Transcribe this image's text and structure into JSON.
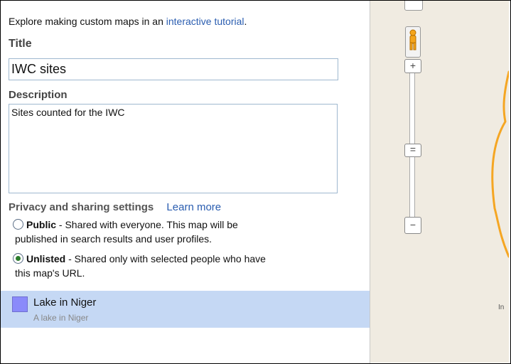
{
  "intro": {
    "prefix": "Explore making custom maps in an ",
    "link": "interactive tutorial",
    "suffix": "."
  },
  "form": {
    "title_label": "Title",
    "title_value": "IWC sites",
    "description_label": "Description",
    "description_value": "Sites counted for the IWC"
  },
  "privacy": {
    "label": "Privacy and sharing settings",
    "learn_more": "Learn more",
    "options": [
      {
        "title": "Public",
        "line1": " - Shared with everyone. This map will be",
        "line2": "published in search results and user profiles.",
        "selected": false
      },
      {
        "title": "Unlisted",
        "line1": " - Shared only with selected people who have",
        "line2": "this map's URL.",
        "selected": true
      }
    ]
  },
  "layer": {
    "name": "Lake in Niger",
    "description": "A lake in Niger",
    "color": "#8a8afa"
  },
  "map": {
    "zoom_in": "+",
    "zoom_handle": "=",
    "zoom_out": "−",
    "edge_label": "In ",
    "route_color": "#f5a623"
  }
}
